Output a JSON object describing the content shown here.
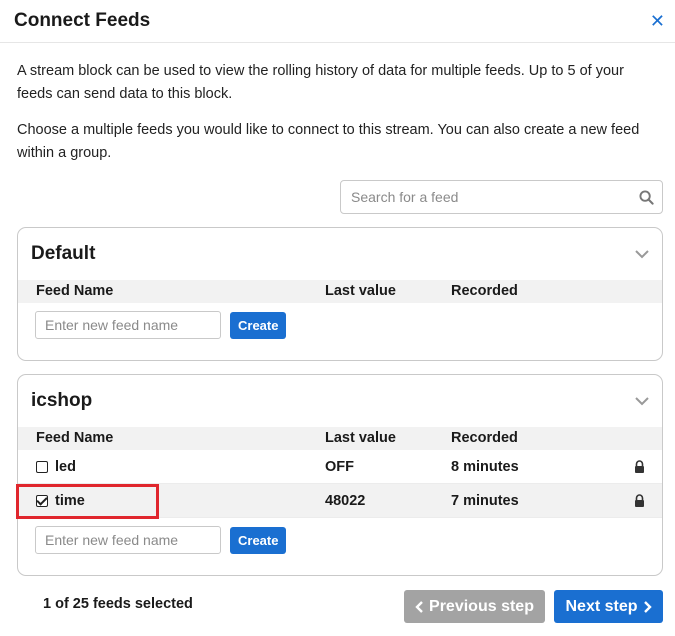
{
  "modal": {
    "title": "Connect Feeds",
    "close_icon": "close-icon"
  },
  "description": {
    "line1": "A stream block can be used to view the rolling history of data for multiple feeds. Up to 5 of your feeds can send data to this block.",
    "line2": "Choose a multiple feeds you would like to connect to this stream. You can also create a new feed within a group."
  },
  "search": {
    "placeholder": "Search for a feed",
    "value": "",
    "icon": "search-icon"
  },
  "columns": {
    "name": "Feed Name",
    "last": "Last value",
    "recorded": "Recorded"
  },
  "groups": [
    {
      "name": "Default",
      "feeds": [],
      "new_feed_placeholder": "Enter new feed name",
      "create_label": "Create"
    },
    {
      "name": "icshop",
      "feeds": [
        {
          "name": "led",
          "last": "OFF",
          "recorded": "8 minutes",
          "checked": false
        },
        {
          "name": "time",
          "last": "48022",
          "recorded": "7 minutes",
          "checked": true
        }
      ],
      "new_feed_placeholder": "Enter new feed name",
      "create_label": "Create"
    }
  ],
  "footer": {
    "count_text": "1 of 25 feeds selected",
    "prev_label": "Previous step",
    "next_label": "Next step"
  },
  "colors": {
    "accent": "#1a6fd1",
    "disabled": "#a3a3a3",
    "highlight": "#e0262d"
  }
}
